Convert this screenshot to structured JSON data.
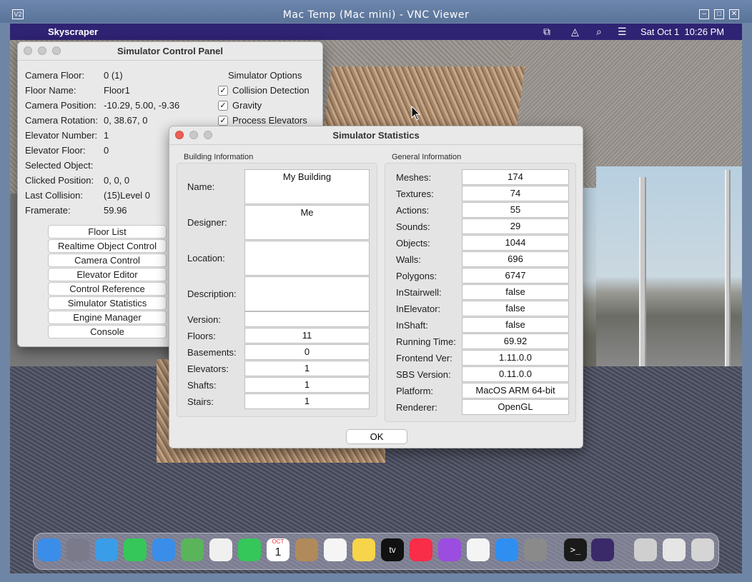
{
  "vnc": {
    "title": "Mac Temp (Mac mini) - VNC Viewer",
    "logo": "V2"
  },
  "menubar": {
    "app_name": "Skyscraper",
    "date": "Sat Oct 1",
    "time": "10:26 PM"
  },
  "control_panel": {
    "title": "Simulator Control Panel",
    "fields": [
      {
        "label": "Camera Floor:",
        "value": "0 (1)"
      },
      {
        "label": "Floor Name:",
        "value": "Floor1"
      },
      {
        "label": "Camera Position:",
        "value": "-10.29, 5.00, -9.36"
      },
      {
        "label": "Camera Rotation:",
        "value": "0, 38.67, 0"
      },
      {
        "label": "Elevator Number:",
        "value": "1"
      },
      {
        "label": "Elevator Floor:",
        "value": "0"
      },
      {
        "label": "Selected Object:",
        "value": ""
      },
      {
        "label": "Clicked Position:",
        "value": "0, 0, 0"
      },
      {
        "label": "Last Collision:",
        "value": "(15)Level 0"
      },
      {
        "label": "Framerate:",
        "value": "59.96"
      }
    ],
    "options_title": "Simulator Options",
    "options": [
      {
        "label": "Collision Detection",
        "checked": true
      },
      {
        "label": "Gravity",
        "checked": true
      },
      {
        "label": "Process Elevators",
        "checked": true
      }
    ],
    "buttons": [
      "Floor List",
      "Realtime Object Control",
      "Camera Control",
      "Elevator Editor",
      "Control Reference",
      "Simulator Statistics",
      "Engine Manager",
      "Console"
    ]
  },
  "stats": {
    "title": "Simulator Statistics",
    "building_title": "Building Information",
    "general_title": "General Information",
    "building": [
      {
        "label": "Name:",
        "value": "My Building"
      },
      {
        "label": "Designer:",
        "value": "Me"
      },
      {
        "label": "Location:",
        "value": ""
      },
      {
        "label": "Description:",
        "value": ""
      },
      {
        "label": "Version:",
        "value": ""
      },
      {
        "label": "Floors:",
        "value": "11"
      },
      {
        "label": "Basements:",
        "value": "0"
      },
      {
        "label": "Elevators:",
        "value": "1"
      },
      {
        "label": "Shafts:",
        "value": "1"
      },
      {
        "label": "Stairs:",
        "value": "1"
      }
    ],
    "general": [
      {
        "label": "Meshes:",
        "value": "174"
      },
      {
        "label": "Textures:",
        "value": "74"
      },
      {
        "label": "Actions:",
        "value": "55"
      },
      {
        "label": "Sounds:",
        "value": "29"
      },
      {
        "label": "Objects:",
        "value": "1044"
      },
      {
        "label": "Walls:",
        "value": "696"
      },
      {
        "label": "Polygons:",
        "value": "6747"
      },
      {
        "label": "InStairwell:",
        "value": "false"
      },
      {
        "label": "InElevator:",
        "value": "false"
      },
      {
        "label": "InShaft:",
        "value": "false"
      },
      {
        "label": "Running Time:",
        "value": "69.92"
      },
      {
        "label": "Frontend Ver:",
        "value": "1.11.0.0"
      },
      {
        "label": "SBS Version:",
        "value": "0.11.0.0"
      },
      {
        "label": "Platform:",
        "value": "MacOS ARM 64-bit"
      },
      {
        "label": "Renderer:",
        "value": "OpenGL"
      }
    ],
    "ok_label": "OK"
  },
  "dock": {
    "calendar_month": "OCT",
    "calendar_day": "1",
    "tv_label": "tv",
    "icons": [
      "finder-icon",
      "launchpad-icon",
      "safari-icon",
      "messages-icon",
      "mail-icon",
      "maps-icon",
      "photos-icon",
      "facetime-icon",
      "calendar-icon",
      "contacts-icon",
      "reminders-icon",
      "notes-icon",
      "tv-icon",
      "music-icon",
      "podcasts-icon",
      "news-icon",
      "app-store-icon",
      "system-preferences-icon",
      "terminal-icon",
      "skyscraper-icon",
      "preview-icon",
      "screenshot-icon",
      "trash-icon"
    ]
  }
}
